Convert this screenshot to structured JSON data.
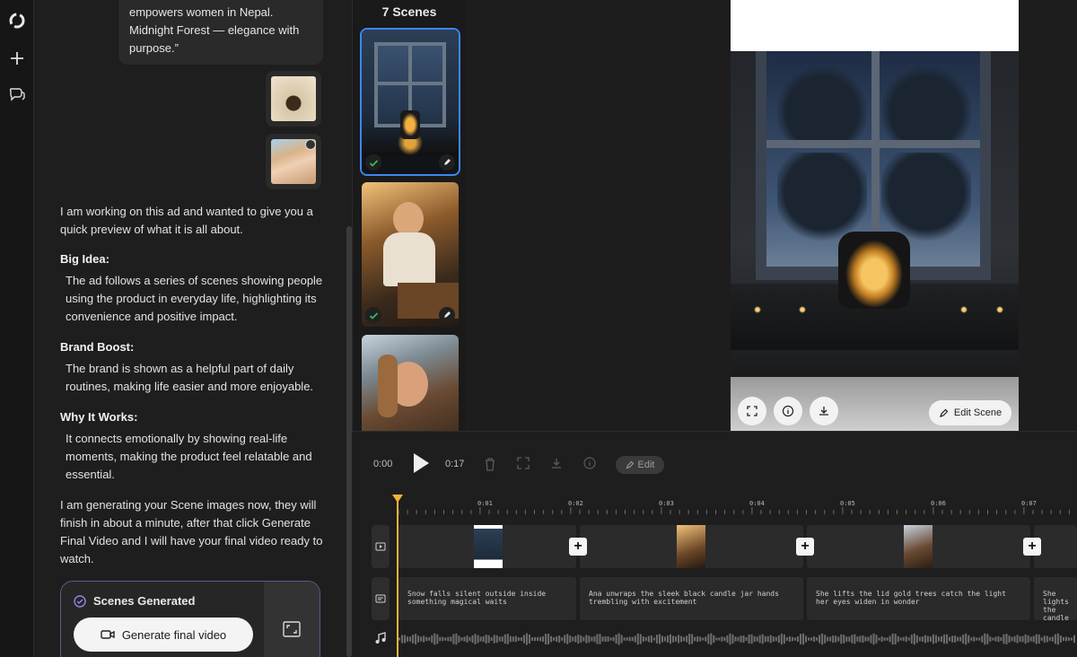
{
  "chat": {
    "quote_text": "empowers women in Nepal. Midnight Forest — elegance with purpose.”",
    "intro": "I am working on this ad and wanted to give you a quick preview of what it is all about.",
    "sections": [
      {
        "heading": "Big Idea:",
        "body": "The ad follows a series of scenes showing people using the product in everyday life, highlighting its convenience and positive impact."
      },
      {
        "heading": "Brand Boost:",
        "body": "The brand is shown as a helpful part of daily routines, making life easier and more enjoyable."
      },
      {
        "heading": "Why It Works:",
        "body": "It connects emotionally by showing real-life moments, making the product feel relatable and essential."
      }
    ],
    "closing": "I am generating your Scene images now, they will finish in about a minute, after that click Generate Final Video and I will have your final video ready to watch.",
    "status_title": "Scenes Generated",
    "generate_button": "Generate final video"
  },
  "scenes": {
    "title": "7 Scenes"
  },
  "preview": {
    "edit_scene_label": "Edit Scene"
  },
  "timeline": {
    "time_start": "0:00",
    "time_end": "0:17",
    "edit_label": "Edit",
    "ruler_labels": [
      "0:01",
      "0:02",
      "0:03",
      "0:04",
      "0:05",
      "0:06",
      "0:07"
    ],
    "captions": [
      "Snow falls silent outside inside something magical waits",
      "Ana unwraps the sleek black candle jar hands trembling with excitement",
      "She lifts the lid gold trees catch the light her eyes widen in wonder",
      "She lights the candle and deep"
    ]
  },
  "colors": {
    "accent_blue": "#3f86f0",
    "playhead": "#f4b33a",
    "check_green": "#2fbf5a",
    "card_border": "#5d5a8a"
  }
}
